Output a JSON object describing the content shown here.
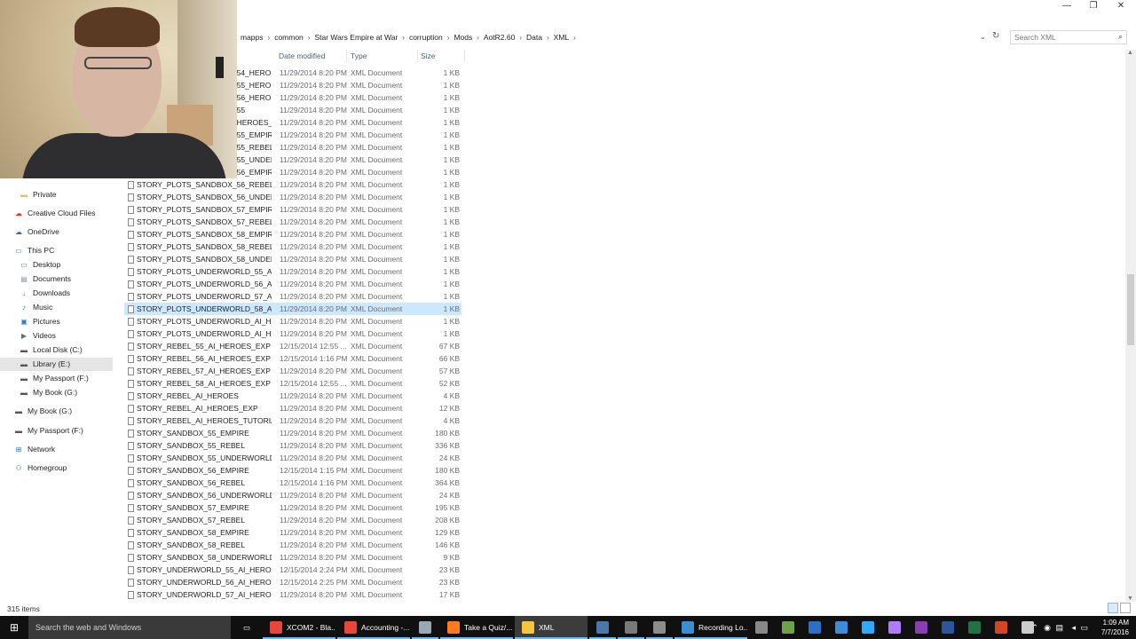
{
  "window": {
    "minimize": "—",
    "maximize": "❐",
    "close": "✕"
  },
  "address": {
    "crumbs": [
      "mapps",
      "common",
      "Star Wars Empire at War",
      "corruption",
      "Mods",
      "AotR2.60",
      "Data",
      "XML"
    ],
    "search_placeholder": "Search XML"
  },
  "columns": {
    "date": "Date modified",
    "type": "Type",
    "size": "Size"
  },
  "sidebar": [
    {
      "label": "Private",
      "icon": "folder-icon",
      "indent": 1
    },
    {
      "label": "Creative Cloud Files",
      "icon": "cloud-icon",
      "indent": 0
    },
    {
      "label": "OneDrive",
      "icon": "onedrive-icon",
      "indent": 0
    },
    {
      "label": "This PC",
      "icon": "computer-icon",
      "indent": 0
    },
    {
      "label": "Desktop",
      "icon": "desktop-icon",
      "indent": 1
    },
    {
      "label": "Documents",
      "icon": "documents-icon",
      "indent": 1
    },
    {
      "label": "Downloads",
      "icon": "downloads-icon",
      "indent": 1
    },
    {
      "label": "Music",
      "icon": "music-icon",
      "indent": 1
    },
    {
      "label": "Pictures",
      "icon": "pictures-icon",
      "indent": 1
    },
    {
      "label": "Videos",
      "icon": "videos-icon",
      "indent": 1
    },
    {
      "label": "Local Disk (C:)",
      "icon": "drive-icon",
      "indent": 1
    },
    {
      "label": "Library (E:)",
      "icon": "drive-icon",
      "indent": 1,
      "selected": true
    },
    {
      "label": "My Passport (F:)",
      "icon": "drive-icon",
      "indent": 1
    },
    {
      "label": "My Book (G:)",
      "icon": "drive-icon",
      "indent": 1
    },
    {
      "label": "My Book (G:)",
      "icon": "drive-icon",
      "indent": 0
    },
    {
      "label": "My Passport (F:)",
      "icon": "drive-icon",
      "indent": 0
    },
    {
      "label": "Network",
      "icon": "network-icon",
      "indent": 0
    },
    {
      "label": "Homegroup",
      "icon": "homegroup-icon",
      "indent": 0
    }
  ],
  "files": [
    {
      "name": "STORY_PLOTS_SANDBOX_54_HEROES_EXP",
      "date": "11/29/2014 8:20 PM",
      "type": "XML Document",
      "size": "1 KB"
    },
    {
      "name": "STORY_PLOTS_SANDBOX_55_HEROES_EXP",
      "date": "11/29/2014 8:20 PM",
      "type": "XML Document",
      "size": "1 KB"
    },
    {
      "name": "STORY_PLOTS_SANDBOX_56_HEROES_EXP",
      "date": "11/29/2014 8:20 PM",
      "type": "XML Document",
      "size": "1 KB"
    },
    {
      "name": "STORY_PLOTS_SANDBOX_55",
      "date": "11/29/2014 8:20 PM",
      "type": "XML Document",
      "size": "1 KB"
    },
    {
      "name": "STORY_PLOTS_SANDBOX_HEROES_EXP",
      "date": "11/29/2014 8:20 PM",
      "type": "XML Document",
      "size": "1 KB"
    },
    {
      "name": "STORY_PLOTS_SANDBOX_55_EMPIRE",
      "date": "11/29/2014 8:20 PM",
      "type": "XML Document",
      "size": "1 KB"
    },
    {
      "name": "STORY_PLOTS_SANDBOX_55_REBEL",
      "date": "11/29/2014 8:20 PM",
      "type": "XML Document",
      "size": "1 KB"
    },
    {
      "name": "STORY_PLOTS_SANDBOX_55_UNDERWO...",
      "date": "11/29/2014 8:20 PM",
      "type": "XML Document",
      "size": "1 KB"
    },
    {
      "name": "STORY_PLOTS_SANDBOX_56_EMPIRE",
      "date": "11/29/2014 8:20 PM",
      "type": "XML Document",
      "size": "1 KB"
    },
    {
      "name": "STORY_PLOTS_SANDBOX_56_REBEL",
      "date": "11/29/2014 8:20 PM",
      "type": "XML Document",
      "size": "1 KB"
    },
    {
      "name": "STORY_PLOTS_SANDBOX_56_UNDERWO...",
      "date": "11/29/2014 8:20 PM",
      "type": "XML Document",
      "size": "1 KB"
    },
    {
      "name": "STORY_PLOTS_SANDBOX_57_EMPIRE",
      "date": "11/29/2014 8:20 PM",
      "type": "XML Document",
      "size": "1 KB"
    },
    {
      "name": "STORY_PLOTS_SANDBOX_57_REBEL",
      "date": "11/29/2014 8:20 PM",
      "type": "XML Document",
      "size": "1 KB"
    },
    {
      "name": "STORY_PLOTS_SANDBOX_58_EMPIRE",
      "date": "11/29/2014 8:20 PM",
      "type": "XML Document",
      "size": "1 KB"
    },
    {
      "name": "STORY_PLOTS_SANDBOX_58_REBEL",
      "date": "11/29/2014 8:20 PM",
      "type": "XML Document",
      "size": "1 KB"
    },
    {
      "name": "STORY_PLOTS_SANDBOX_58_UNDERWO...",
      "date": "11/29/2014 8:20 PM",
      "type": "XML Document",
      "size": "1 KB"
    },
    {
      "name": "STORY_PLOTS_UNDERWORLD_55_AI_HE...",
      "date": "11/29/2014 8:20 PM",
      "type": "XML Document",
      "size": "1 KB"
    },
    {
      "name": "STORY_PLOTS_UNDERWORLD_56_AI_HE...",
      "date": "11/29/2014 8:20 PM",
      "type": "XML Document",
      "size": "1 KB"
    },
    {
      "name": "STORY_PLOTS_UNDERWORLD_57_AI_HE...",
      "date": "11/29/2014 8:20 PM",
      "type": "XML Document",
      "size": "1 KB"
    },
    {
      "name": "STORY_PLOTS_UNDERWORLD_58_AI_HE...",
      "date": "11/29/2014 8:20 PM",
      "type": "XML Document",
      "size": "1 KB",
      "selected": true
    },
    {
      "name": "STORY_PLOTS_UNDERWORLD_AI_HEROES",
      "date": "11/29/2014 8:20 PM",
      "type": "XML Document",
      "size": "1 KB"
    },
    {
      "name": "STORY_PLOTS_UNDERWORLD_AI_HEROE...",
      "date": "11/29/2014 8:20 PM",
      "type": "XML Document",
      "size": "1 KB"
    },
    {
      "name": "STORY_REBEL_55_AI_HEROES_EXP",
      "date": "12/15/2014 12:55 ...",
      "type": "XML Document",
      "size": "67 KB"
    },
    {
      "name": "STORY_REBEL_56_AI_HEROES_EXP",
      "date": "12/15/2014 1:16 PM",
      "type": "XML Document",
      "size": "66 KB"
    },
    {
      "name": "STORY_REBEL_57_AI_HEROES_EXP",
      "date": "11/29/2014 8:20 PM",
      "type": "XML Document",
      "size": "57 KB"
    },
    {
      "name": "STORY_REBEL_58_AI_HEROES_EXP",
      "date": "12/15/2014 12:55 ...",
      "type": "XML Document",
      "size": "52 KB"
    },
    {
      "name": "STORY_REBEL_AI_HEROES",
      "date": "11/29/2014 8:20 PM",
      "type": "XML Document",
      "size": "4 KB"
    },
    {
      "name": "STORY_REBEL_AI_HEROES_EXP",
      "date": "11/29/2014 8:20 PM",
      "type": "XML Document",
      "size": "12 KB"
    },
    {
      "name": "STORY_REBEL_AI_HEROES_TUTORIAL",
      "date": "11/29/2014 8:20 PM",
      "type": "XML Document",
      "size": "4 KB"
    },
    {
      "name": "STORY_SANDBOX_55_EMPIRE",
      "date": "11/29/2014 8:20 PM",
      "type": "XML Document",
      "size": "180 KB"
    },
    {
      "name": "STORY_SANDBOX_55_REBEL",
      "date": "11/29/2014 8:20 PM",
      "type": "XML Document",
      "size": "336 KB"
    },
    {
      "name": "STORY_SANDBOX_55_UNDERWORLD",
      "date": "11/29/2014 8:20 PM",
      "type": "XML Document",
      "size": "24 KB"
    },
    {
      "name": "STORY_SANDBOX_56_EMPIRE",
      "date": "12/15/2014 1:15 PM",
      "type": "XML Document",
      "size": "180 KB"
    },
    {
      "name": "STORY_SANDBOX_56_REBEL",
      "date": "12/15/2014 1:16 PM",
      "type": "XML Document",
      "size": "364 KB"
    },
    {
      "name": "STORY_SANDBOX_56_UNDERWORLD",
      "date": "11/29/2014 8:20 PM",
      "type": "XML Document",
      "size": "24 KB"
    },
    {
      "name": "STORY_SANDBOX_57_EMPIRE",
      "date": "11/29/2014 8:20 PM",
      "type": "XML Document",
      "size": "195 KB"
    },
    {
      "name": "STORY_SANDBOX_57_REBEL",
      "date": "11/29/2014 8:20 PM",
      "type": "XML Document",
      "size": "208 KB"
    },
    {
      "name": "STORY_SANDBOX_58_EMPIRE",
      "date": "11/29/2014 8:20 PM",
      "type": "XML Document",
      "size": "129 KB"
    },
    {
      "name": "STORY_SANDBOX_58_REBEL",
      "date": "11/29/2014 8:20 PM",
      "type": "XML Document",
      "size": "146 KB"
    },
    {
      "name": "STORY_SANDBOX_58_UNDERWORLD",
      "date": "11/29/2014 8:20 PM",
      "type": "XML Document",
      "size": "9 KB"
    },
    {
      "name": "STORY_UNDERWORLD_55_AI_HEROES",
      "date": "12/15/2014 2:24 PM",
      "type": "XML Document",
      "size": "23 KB"
    },
    {
      "name": "STORY_UNDERWORLD_56_AI_HEROES",
      "date": "12/15/2014 2:25 PM",
      "type": "XML Document",
      "size": "23 KB"
    },
    {
      "name": "STORY_UNDERWORLD_57_AI_HEROES",
      "date": "11/29/2014 8:20 PM",
      "type": "XML Document",
      "size": "17 KB"
    }
  ],
  "status": {
    "count": "315 items"
  },
  "taskbar": {
    "search": "Search the web and Windows",
    "apps": [
      {
        "label": "XCOM2 - Bla...",
        "icon": "chrome-icon",
        "color": "#e8453c"
      },
      {
        "label": "Accounting -...",
        "icon": "chrome-icon",
        "color": "#e8453c"
      },
      {
        "label": "",
        "icon": "app-icon",
        "color": "#9aa7b5"
      },
      {
        "label": "Take a Quiz/...",
        "icon": "firefox-icon",
        "color": "#ff7b1c"
      },
      {
        "label": "XML",
        "icon": "folder-icon",
        "color": "#f5c542",
        "active": true
      },
      {
        "label": "",
        "icon": "steam-icon",
        "color": "#4b78a8"
      },
      {
        "label": "",
        "icon": "app-icon",
        "color": "#7a7a7a"
      },
      {
        "label": "",
        "icon": "app-icon",
        "color": "#8c8c8c"
      },
      {
        "label": "Recording Lo...",
        "icon": "obs-icon",
        "color": "#3b8ed0"
      }
    ],
    "pinned": [
      {
        "icon": "app-icon",
        "color": "#888888"
      },
      {
        "icon": "app-icon",
        "color": "#6ea34a"
      },
      {
        "icon": "app-icon",
        "color": "#2d6fc4"
      },
      {
        "icon": "app-icon",
        "color": "#3e8bd9"
      },
      {
        "icon": "photoshop-icon",
        "color": "#31a8ff"
      },
      {
        "icon": "premiere-icon",
        "color": "#b07cff"
      },
      {
        "icon": "onenote-icon",
        "color": "#8b3db5"
      },
      {
        "icon": "word-icon",
        "color": "#2b579a"
      },
      {
        "icon": "excel-icon",
        "color": "#217346"
      },
      {
        "icon": "powerpoint-icon",
        "color": "#d24726"
      },
      {
        "icon": "calculator-icon",
        "color": "#cccccc"
      }
    ],
    "time": "1:09 AM",
    "date": "7/7/2016"
  }
}
